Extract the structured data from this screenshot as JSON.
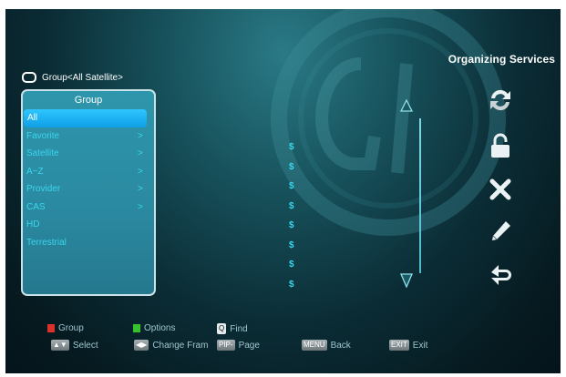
{
  "screen_title": "Organizing Services",
  "header": {
    "group_label": "Group<All Satellite>"
  },
  "group_panel": {
    "title": "Group",
    "items": [
      {
        "label": "All",
        "arrow": ""
      },
      {
        "label": "Favorite",
        "arrow": ">"
      },
      {
        "label": "Satellite",
        "arrow": ">"
      },
      {
        "label": "A~Z",
        "arrow": ">"
      },
      {
        "label": "Provider",
        "arrow": ">"
      },
      {
        "label": "CAS",
        "arrow": ">"
      },
      {
        "label": "HD",
        "arrow": ""
      },
      {
        "label": "Terrestrial",
        "arrow": ""
      }
    ]
  },
  "service_markers": [
    "$",
    "$",
    "$",
    "$",
    "$",
    "$",
    "$",
    "$"
  ],
  "side_icons": [
    "move-icon",
    "lock-icon",
    "delete-icon",
    "rename-icon",
    "undo-icon"
  ],
  "footer": {
    "group": "Group",
    "options": "Options",
    "find_key": "Q",
    "find": "Find",
    "select": "Select",
    "change_frame": "Change Fram",
    "pip_key": "PIP-",
    "page": "Page",
    "menu_key": "MENU",
    "back": "Back",
    "exit_key": "EXIT",
    "exit": "Exit"
  },
  "colors": {
    "accent": "#2fc6ff",
    "list_text": "#3ad6ee",
    "red_key": "#d9322b",
    "green_key": "#36c22d"
  }
}
